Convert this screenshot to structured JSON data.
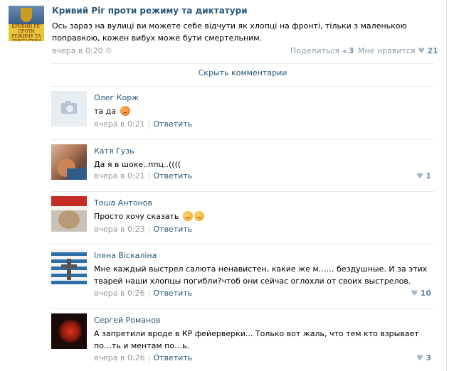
{
  "post": {
    "author": "Кривий Ріг проти режиму та диктатури",
    "avatar_text": "КРИВИЙ РІГ ПРОТИ РЕЖИМУ ТА ДИКТАТУРИ",
    "text": "Ось зараз на вулиці ви можете себе відчути як хлопці на фронті, тільки з маленькою поправкою, кожен вибух може бути смертельним.",
    "time": "вчера в 0:20",
    "share_label": "Поделиться",
    "share_count": "3",
    "like_label": "Мне нравится",
    "like_count": "21"
  },
  "hide_comments": "Скрыть комментарии",
  "reply_label": "Ответить",
  "comments": [
    {
      "name": "Олег Корж",
      "text": "та да",
      "time": "вчера в 0:21",
      "likes": "",
      "avatar": "camera-placeholder"
    },
    {
      "name": "Катя Гузь",
      "text": "Да я в шоке..ппц..((((",
      "time": "вчера в 0:21",
      "likes": "1",
      "avatar": "child-photo"
    },
    {
      "name": "Тоша Антонов",
      "text": "Просто хочу сказать",
      "time": "вчера в 0:23",
      "likes": "",
      "avatar": "cat-in-santa-hat"
    },
    {
      "name": "Іляна Віскаліна",
      "text": "Мне каждый выстрел салюта ненавистен, какие же м…… бездушные. И за этих тварей наши хлопцы погибли?чтоб они сейчас оглохли от своих выстрелов.",
      "time": "вчера в 0:26",
      "likes": "10",
      "avatar": "cross-necklace"
    },
    {
      "name": "Сергей Романов",
      "text": "А запретили вроде в КР фейерверки... Только вот жаль, что тем кто взрывает по…ть и ментам по…ь.",
      "time": "вчера в 0:26",
      "likes": "3",
      "avatar": "red-guitar"
    }
  ],
  "colors": {
    "link": "#2b587a",
    "meta": "#999999",
    "like": "#8a9bb0"
  }
}
